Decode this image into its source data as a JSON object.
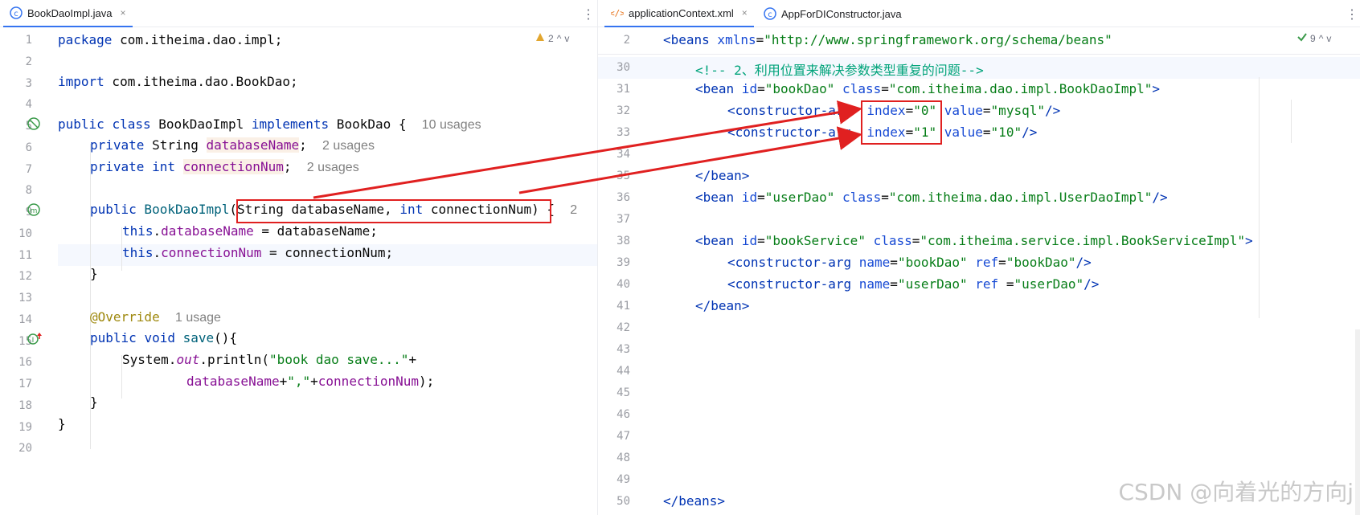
{
  "left_tab": {
    "title": "BookDaoImpl.java",
    "close": "×",
    "menu": "⋮"
  },
  "right_tabs": [
    {
      "title": "applicationContext.xml",
      "close": "×",
      "active": true
    },
    {
      "title": "AppForDIConstructor.java",
      "active": false
    }
  ],
  "right_menu": "⋮",
  "left_inspection": {
    "count": "2",
    "up": "^",
    "down": "v"
  },
  "right_inspection": {
    "count": "9",
    "up": "^",
    "down": "v"
  },
  "left_lines": [
    "1",
    "2",
    "3",
    "4",
    "5",
    "6",
    "7",
    "8",
    "9",
    "10",
    "11",
    "12",
    "13",
    "14",
    "15",
    "16",
    "17",
    "18",
    "19",
    "20"
  ],
  "left_code": {
    "l1_kw": "package",
    "l1_rest": " com.itheima.dao.impl;",
    "l3_kw": "import",
    "l3_rest": " com.itheima.dao.BookDao;",
    "l5_kw1": "public",
    "l5_kw2": "class",
    "l5_name": " BookDaoImpl ",
    "l5_kw3": "implements",
    "l5_rest": " BookDao {",
    "l5_hint": "10 usages",
    "l6_kw": "private",
    "l6_type": " String ",
    "l6_field": "databaseName",
    "l6_semi": ";",
    "l6_hint": "2 usages",
    "l7_kw": "private",
    "l7_type": " int ",
    "l7_field": "connectionNum",
    "l7_semi": ";",
    "l7_hint": "2 usages",
    "l9_kw": "public",
    "l9_name": " BookDaoImpl",
    "l9_paren": "(",
    "l9_p1": "String databaseName, ",
    "l9_int": "int",
    "l9_p2": " connectionNum",
    "l9_close": ") {",
    "l9_hint": "2",
    "l10_this": "this",
    "l10_dot": ".",
    "l10_field": "databaseName",
    "l10_rest": " = databaseName;",
    "l11_this": "this",
    "l11_dot": ".",
    "l11_field": "connectionNum",
    "l11_rest": " = connectionNum;",
    "l12": "}",
    "l14_anno": "@Override",
    "l14_hint": "1 usage",
    "l15_kw1": "public",
    "l15_kw2": "void",
    "l15_name": " save",
    "l15_rest": "(){",
    "l16_sys": "System.",
    "l16_out": "out",
    "l16_mid": ".println(",
    "l16_str": "\"book dao save...\"",
    "l16_plus": "+",
    "l17_field": "databaseName",
    "l17_plus": "+",
    "l17_str": "\",\"",
    "l17_plus2": "+",
    "l17_field2": "connectionNum",
    "l17_end": ");",
    "l18": "}",
    "l19": "}"
  },
  "right_lines": [
    "2",
    "30",
    "31",
    "32",
    "33",
    "34",
    "35",
    "36",
    "37",
    "38",
    "39",
    "40",
    "41",
    "42",
    "43",
    "44",
    "45",
    "46",
    "47",
    "48",
    "49",
    "50"
  ],
  "right_code": {
    "r2_tag": "<beans",
    "r2_attr": " xmlns",
    "r2_eq": "=",
    "r2_val": "\"http://www.springframework.org/schema/beans\"",
    "r30_comment": "<!-- 2、利用位置来解决参数类型重复的问题-->",
    "r31_tag": "<bean",
    "r31_a1": " id",
    "r31_v1": "\"bookDao\"",
    "r31_a2": " class",
    "r31_v2": "\"com.itheima.dao.impl.BookDaoImpl\"",
    "r31_end": ">",
    "r32_tag": "<constructor-arg",
    "r32_a1": " index",
    "r32_v1": "\"0\"",
    "r32_a2": " value",
    "r32_v2": "\"mysql\"",
    "r32_end": "/>",
    "r33_tag": "<constructor-arg",
    "r33_a1": " index",
    "r33_v1": "\"1\"",
    "r33_a2": " value",
    "r33_v2": "\"10\"",
    "r33_end": "/>",
    "r35_tag": "</bean>",
    "r36_tag": "<bean",
    "r36_a1": " id",
    "r36_v1": "\"userDao\"",
    "r36_a2": " class",
    "r36_v2": "\"com.itheima.dao.impl.UserDaoImpl\"",
    "r36_end": "/>",
    "r38_tag": "<bean",
    "r38_a1": " id",
    "r38_v1": "\"bookService\"",
    "r38_a2": " class",
    "r38_v2": "\"com.itheima.service.impl.BookServiceImpl\"",
    "r38_end": ">",
    "r39_tag": "<constructor-arg",
    "r39_a1": " name",
    "r39_v1": "\"bookDao\"",
    "r39_a2": " ref",
    "r39_v2": "\"bookDao\"",
    "r39_end": "/>",
    "r40_tag": "<constructor-arg",
    "r40_a1": " name",
    "r40_v1": "\"userDao\"",
    "r40_a2": " ref ",
    "r40_v2": "\"userDao\"",
    "r40_end": "/>",
    "r41_tag": "</bean>",
    "r50_tag": "</beans>",
    "eq": "="
  },
  "watermark": "CSDN @向着光的方向j",
  "colors": {
    "accent": "#3574f0",
    "annotation_red": "#e02020"
  }
}
